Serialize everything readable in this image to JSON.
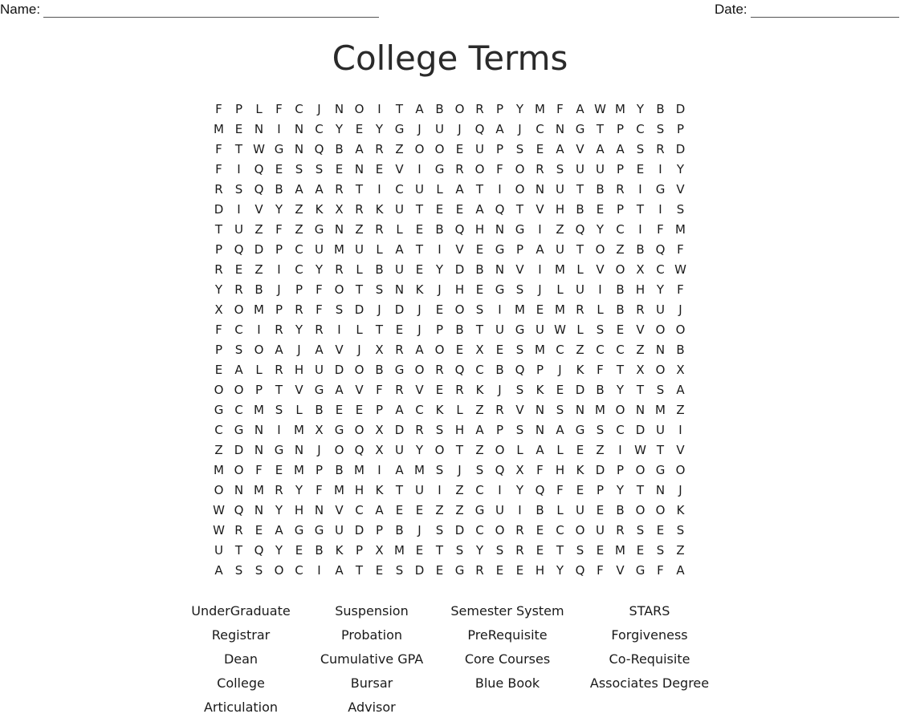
{
  "header": {
    "name_label": "Name:",
    "date_label": "Date:"
  },
  "title": "College Terms",
  "grid": [
    "FPLFCJNOITABORPYMFAWMYBD",
    "MENINCYEYGJUJQAJCNGTPCSP",
    "FTWGNQBARZOOEUPSEAVAASRD",
    "FIQESSENEVIGROFORSUUPEIY",
    "RSQBAARTICULATIONUTBRIGV",
    "DIVYZKXRKUTEEAQTVHBEPTIS",
    "TUZFZGNZRLEBQHNGIZQYCIFM",
    "PQDPCUMULATIVEGPAUTOZBQF",
    "REZICYRLBUEYDBNVIMLVOXCW",
    "YRBJPFOTSNKJHEGSJLUIBHYF",
    "XOMPRFSDJDJEOSIMEMRLBRUJ",
    "FCIRYRILTEJPBTUGUWLSEVOO",
    "PSOAJAVJXRAOEXESMCZCCZNB",
    "EALRHUDOBGORQCBQPJKFTXOX",
    "OOPTVGAVFRVERKJSKEDBYTSA",
    "GCMSLBEEPACKLZRVNSNMONMZ",
    "CGNIMXGOXDRSHAPSNAGSCDUI",
    "ZDNGNJOQXUYOTZOLALEZIWTV",
    "MOFEMPBMIAMSJSQXFHKDPOGO",
    "ONMRYFMHKTUIZCIYQFEPYTNJ",
    "WQNYHNVCAEEZZGUIBLUEBOOK",
    "WREAGGUDPBJSDCORECOURSES",
    "UTQYEBKPXMETSYSRETSEMESZ",
    "ASSOCIATESDEGREEHYQFVGFA"
  ],
  "word_list": {
    "columns": [
      [
        "UnderGraduate",
        "Registrar",
        "Dean",
        "College",
        "Articulation"
      ],
      [
        "Suspension",
        "Probation",
        "Cumulative GPA",
        "Bursar",
        "Advisor"
      ],
      [
        "Semester System",
        "PreRequisite",
        "Core Courses",
        "Blue Book"
      ],
      [
        "STARS",
        "Forgiveness",
        "Co-Requisite",
        "Associates Degree"
      ]
    ]
  }
}
